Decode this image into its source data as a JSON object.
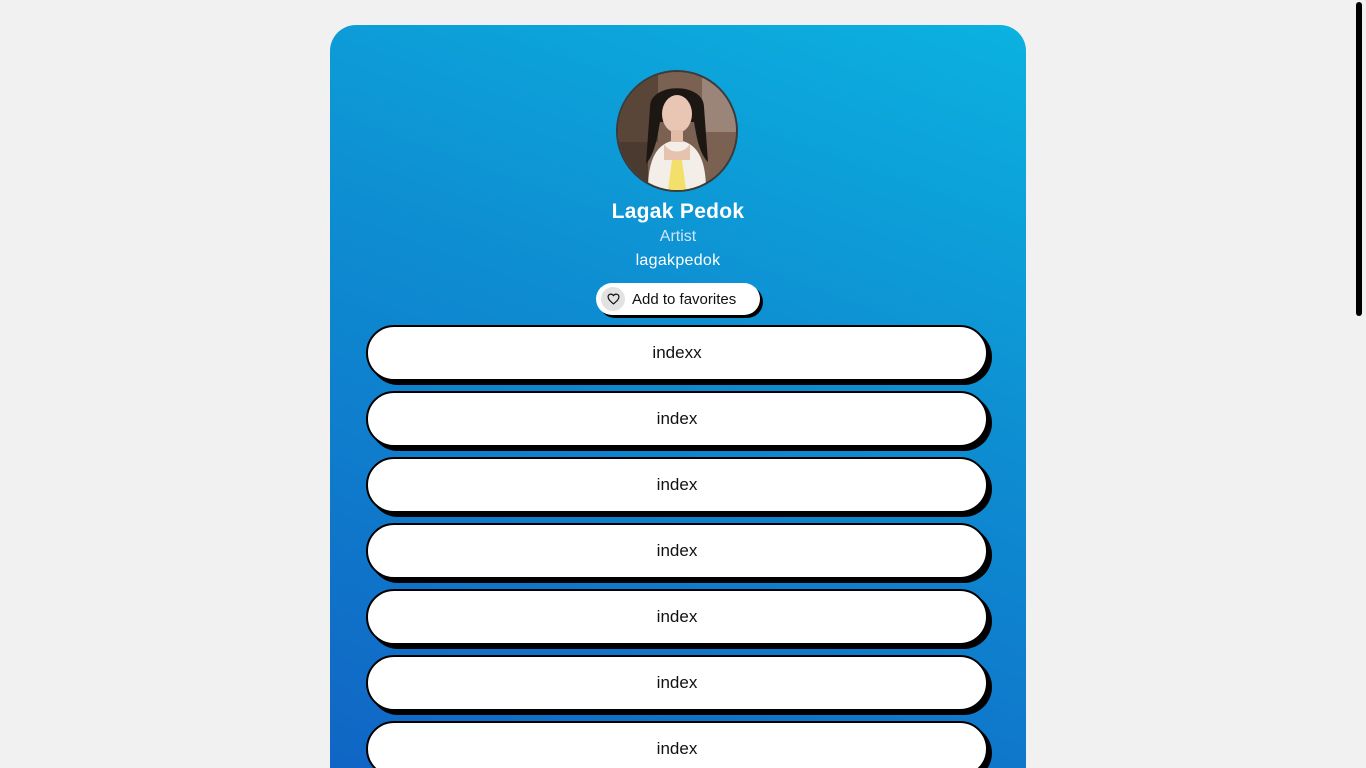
{
  "profile": {
    "name": "Lagak Pedok",
    "role": "Artist",
    "handle": "lagakpedok"
  },
  "favorites_button": {
    "label": "Add to favorites",
    "icon": "heart-icon"
  },
  "links": [
    {
      "label": "indexx"
    },
    {
      "label": "index"
    },
    {
      "label": "index"
    },
    {
      "label": "index"
    },
    {
      "label": "index"
    },
    {
      "label": "index"
    },
    {
      "label": "index"
    }
  ],
  "colors": {
    "page_background": "#f1f1f1",
    "card_gradient_top": "#0bb2e0",
    "card_gradient_bottom": "#1064c4",
    "button_background": "#ffffff",
    "button_border": "#000000"
  }
}
